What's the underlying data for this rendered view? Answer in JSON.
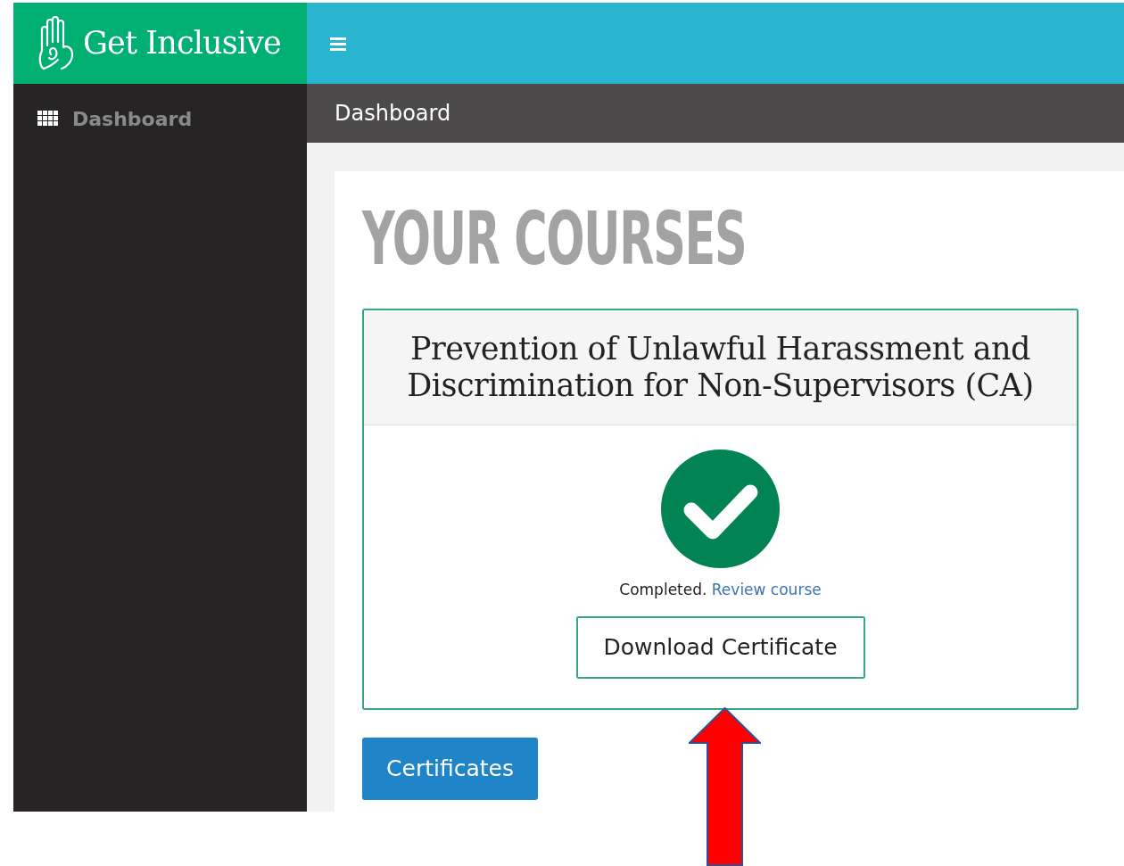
{
  "brand": {
    "name": "Get Inclusive"
  },
  "sidebar": {
    "items": [
      {
        "label": "Dashboard",
        "selected": false
      }
    ]
  },
  "breadcrumb": "Dashboard",
  "heading": "YOUR COURSES",
  "courses": [
    {
      "title": "Prevention of Unlawful Harassment and Discrimination for Non-Supervisors (CA)",
      "status": "Completed.",
      "link": "Review course",
      "completed": true,
      "button": "Download Certificate"
    }
  ],
  "certificates_button": "Certificates"
}
